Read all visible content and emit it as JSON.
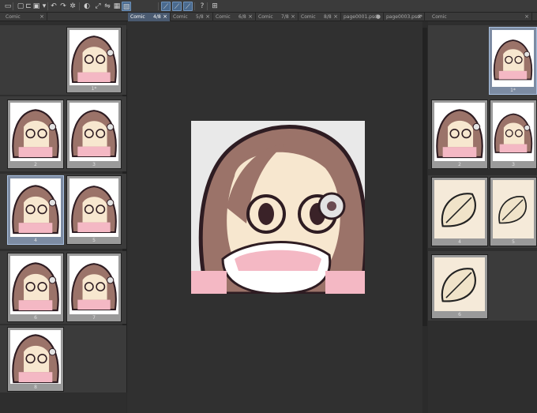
{
  "toolbar": {
    "icons": [
      "monitor-icon",
      "new-file-icon",
      "open-folder-icon",
      "save-icon",
      "chevron-down-icon",
      "undo-icon",
      "redo-icon",
      "loading-icon",
      "paint-bucket-icon",
      "transform-icon",
      "mirror-icon",
      "select-all-icon",
      "deselect-icon",
      "snap-ruler-icon",
      "snap-guide-icon",
      "snap-grid-icon",
      "help-icon",
      "layout-icon"
    ]
  },
  "left_tabs": [
    {
      "label": "Comic",
      "close": "×"
    }
  ],
  "center_tabs": [
    {
      "label": "Comic",
      "count": "4/8",
      "close": "×",
      "active": true
    },
    {
      "label": "Comic",
      "count": "5/8",
      "close": "×"
    },
    {
      "label": "Comic",
      "count": "6/8",
      "close": "×"
    },
    {
      "label": "Comic",
      "count": "7/8",
      "close": "×"
    },
    {
      "label": "Comic",
      "count": "8/8",
      "close": "×"
    },
    {
      "label": "page0001.psd*",
      "count": "",
      "close": "●"
    },
    {
      "label": "page0003.psd*",
      "count": "",
      "close": "×"
    }
  ],
  "right_tabs": [
    {
      "label": "Comic",
      "close": "×",
      "dropdown": "▾"
    }
  ],
  "left_pages": [
    "1*",
    "2",
    "3",
    "4",
    "5",
    "6",
    "7",
    "8"
  ],
  "right_pages": [
    "1*",
    "2",
    "3",
    "4",
    "5",
    "6"
  ],
  "colors": {
    "selection": "#4a5a70",
    "canvas_bg": "#e9e9e9"
  }
}
